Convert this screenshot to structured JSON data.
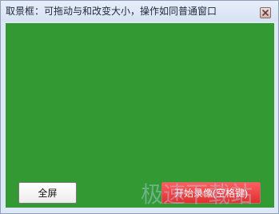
{
  "window": {
    "title": "取景框：可拖动与和改变大小，操作如同普通窗口"
  },
  "capture_area": {
    "color": "#339933"
  },
  "buttons": {
    "fullscreen_label": "全屏",
    "start_record_label": "开始录像(空格键)"
  },
  "watermark": {
    "text": "极速下载站"
  },
  "colors": {
    "title_bar": "#dde8f6",
    "capture_green": "#339933",
    "record_button": "#e53b3b"
  }
}
